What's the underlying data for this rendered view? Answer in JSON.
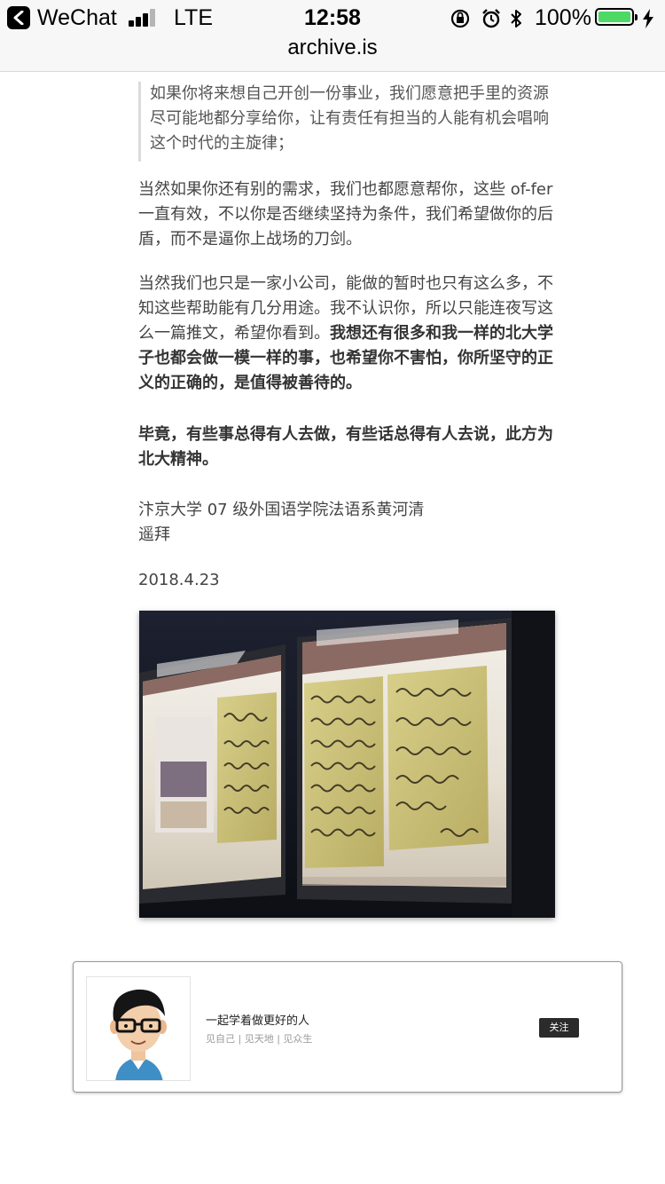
{
  "status_bar": {
    "carrier": "WeChat",
    "network": "LTE",
    "time": "12:58",
    "battery": "100%",
    "battery_color": "#4cd964"
  },
  "header": {
    "url": "archive.is"
  },
  "article": {
    "quote": "如果你将来想自己开创一份事业，我们愿意把手里的资源尽可能地都分享给你，让有责任有担当的人能有机会唱响这个时代的主旋律；",
    "p1": "当然如果你还有别的需求，我们也都愿意帮你，这些 of-fer 一直有效，不以你是否继续坚持为条件，我们希望做你的后盾，而不是逼你上战场的刀剑。",
    "p2_normal": "当然我们也只是一家小公司，能做的暂时也只有这么多，不知这些帮助能有几分用途。我不认识你，所以只能连夜写这么一篇推文，希望你看到。",
    "p2_bold": "我想还有很多和我一样的北大学子也都会做一模一样的事，也希望你不害怕，你所坚守的正义的正确的，是值得被善待的。",
    "p3_bold": "毕竟，有些事总得有人去做，有些话总得有人去说，此方为北大精神。",
    "signature": "汴京大学 07 级外国语学院法语系黄河清",
    "salute": "遥拜",
    "date": "2018.4.23"
  },
  "card": {
    "name": "一起学着做更好的人",
    "description": "见自己 | 见天地 | 见众生",
    "follow_label": "关注"
  }
}
